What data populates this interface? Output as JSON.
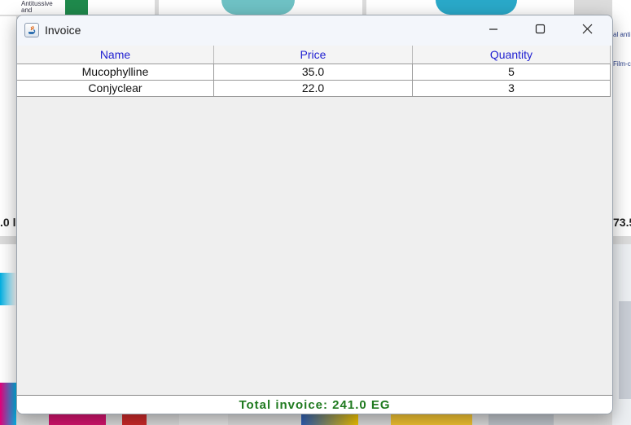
{
  "window": {
    "title": "Invoice",
    "controls": {
      "minimize": "minimize",
      "maximize": "maximize",
      "close": "close"
    }
  },
  "table": {
    "columns": [
      "Name",
      "Price",
      "Quantity"
    ],
    "rows": [
      [
        "Mucophylline",
        "35.0",
        "5"
      ],
      [
        "Conjyclear",
        "22.0",
        "3"
      ]
    ]
  },
  "footer": {
    "total": "Total invoice: 241.0 EG"
  },
  "background": {
    "left_price_fragment": ".0 l",
    "right_price_fragment": "73.5",
    "right_label_fragment_1": "al anti",
    "right_label_fragment_2": "Film-c",
    "left_label_fragment_1": "Antitussive",
    "left_label_fragment_2": "and"
  },
  "colors": {
    "header_text": "#1f1fd1",
    "total_text": "#1f7a1f",
    "window_bg": "#f0f0f0"
  },
  "icons": {
    "app": "java-app-icon",
    "minimize": "minimize-icon",
    "maximize": "maximize-icon",
    "close": "close-icon"
  }
}
